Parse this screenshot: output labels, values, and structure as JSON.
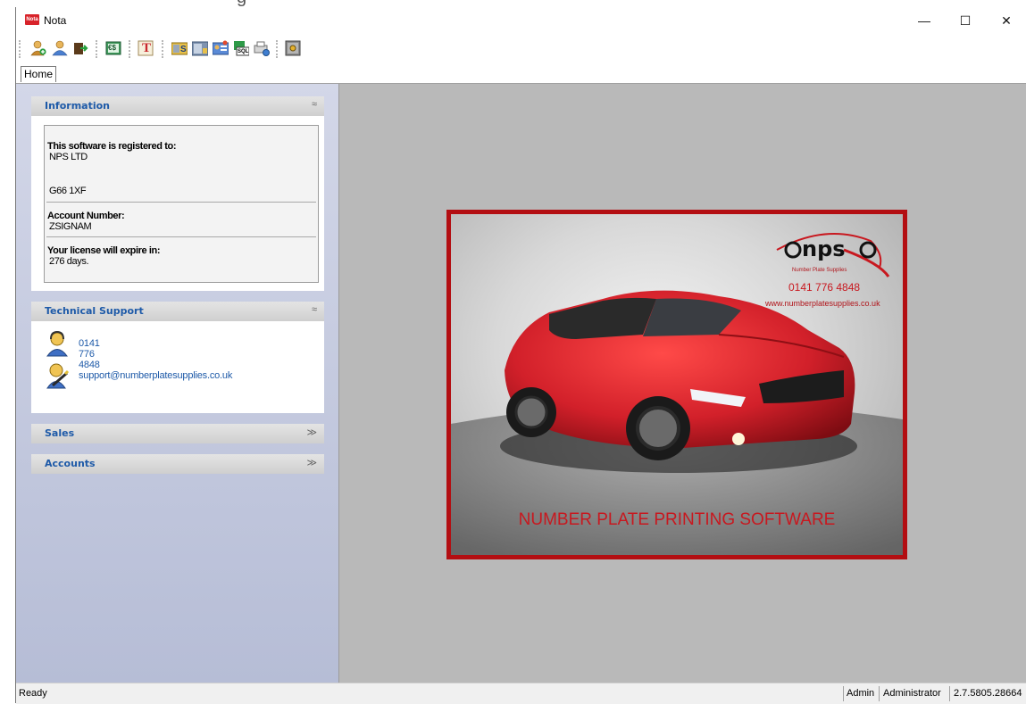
{
  "window": {
    "title": "Nota",
    "app_icon_text": "Nota",
    "controls": {
      "minimize": "—",
      "maximize": "☐",
      "close": "✕"
    }
  },
  "toolbar": {
    "buttons": [
      {
        "icon": "add-customer-icon"
      },
      {
        "icon": "customer-icon"
      },
      {
        "icon": "export-icon"
      },
      {
        "icon": "exit-icon",
        "text": "€$"
      },
      {
        "icon": "text-icon",
        "text": "T"
      },
      {
        "icon": "stock-icon",
        "text": "S"
      },
      {
        "icon": "stock-list-icon"
      },
      {
        "icon": "user-card-icon"
      },
      {
        "icon": "sql-icon",
        "text": "SQL"
      },
      {
        "icon": "printer-settings-icon"
      },
      {
        "icon": "safe-icon"
      }
    ]
  },
  "tabs": [
    {
      "label": "Home",
      "active": true
    }
  ],
  "sidebar": {
    "information": {
      "title": "Information",
      "collapse": "≈",
      "registered_label": "This software is registered to:",
      "company": "NPS LTD",
      "postcode": "G66 1XF",
      "account_label": "Account Number:",
      "account_number": "ZSIGNAM",
      "license_label": "Your license will expire in:",
      "license_days": "276 days."
    },
    "support": {
      "title": "Technical Support",
      "collapse": "≈",
      "phone": "0141 776 4848",
      "email": "support@numberplatesupplies.co.uk"
    },
    "sales": {
      "title": "Sales",
      "expand": "≫"
    },
    "accounts": {
      "title": "Accounts",
      "expand": "≫"
    }
  },
  "poster": {
    "logo_text": "nps",
    "logo_sub": "Number Plate Supplies",
    "phone": "0141 776 4848",
    "website": "www.numberplatesupplies.co.uk",
    "headline": "NUMBER PLATE PRINTING SOFTWARE"
  },
  "status": {
    "left": "Ready",
    "user": "Admin",
    "role": "Administrator",
    "version": "2.7.5805.28664"
  },
  "colors": {
    "accent_blue": "#1e5aa8",
    "brand_red": "#b30e12",
    "car_red": "#d2202a"
  }
}
